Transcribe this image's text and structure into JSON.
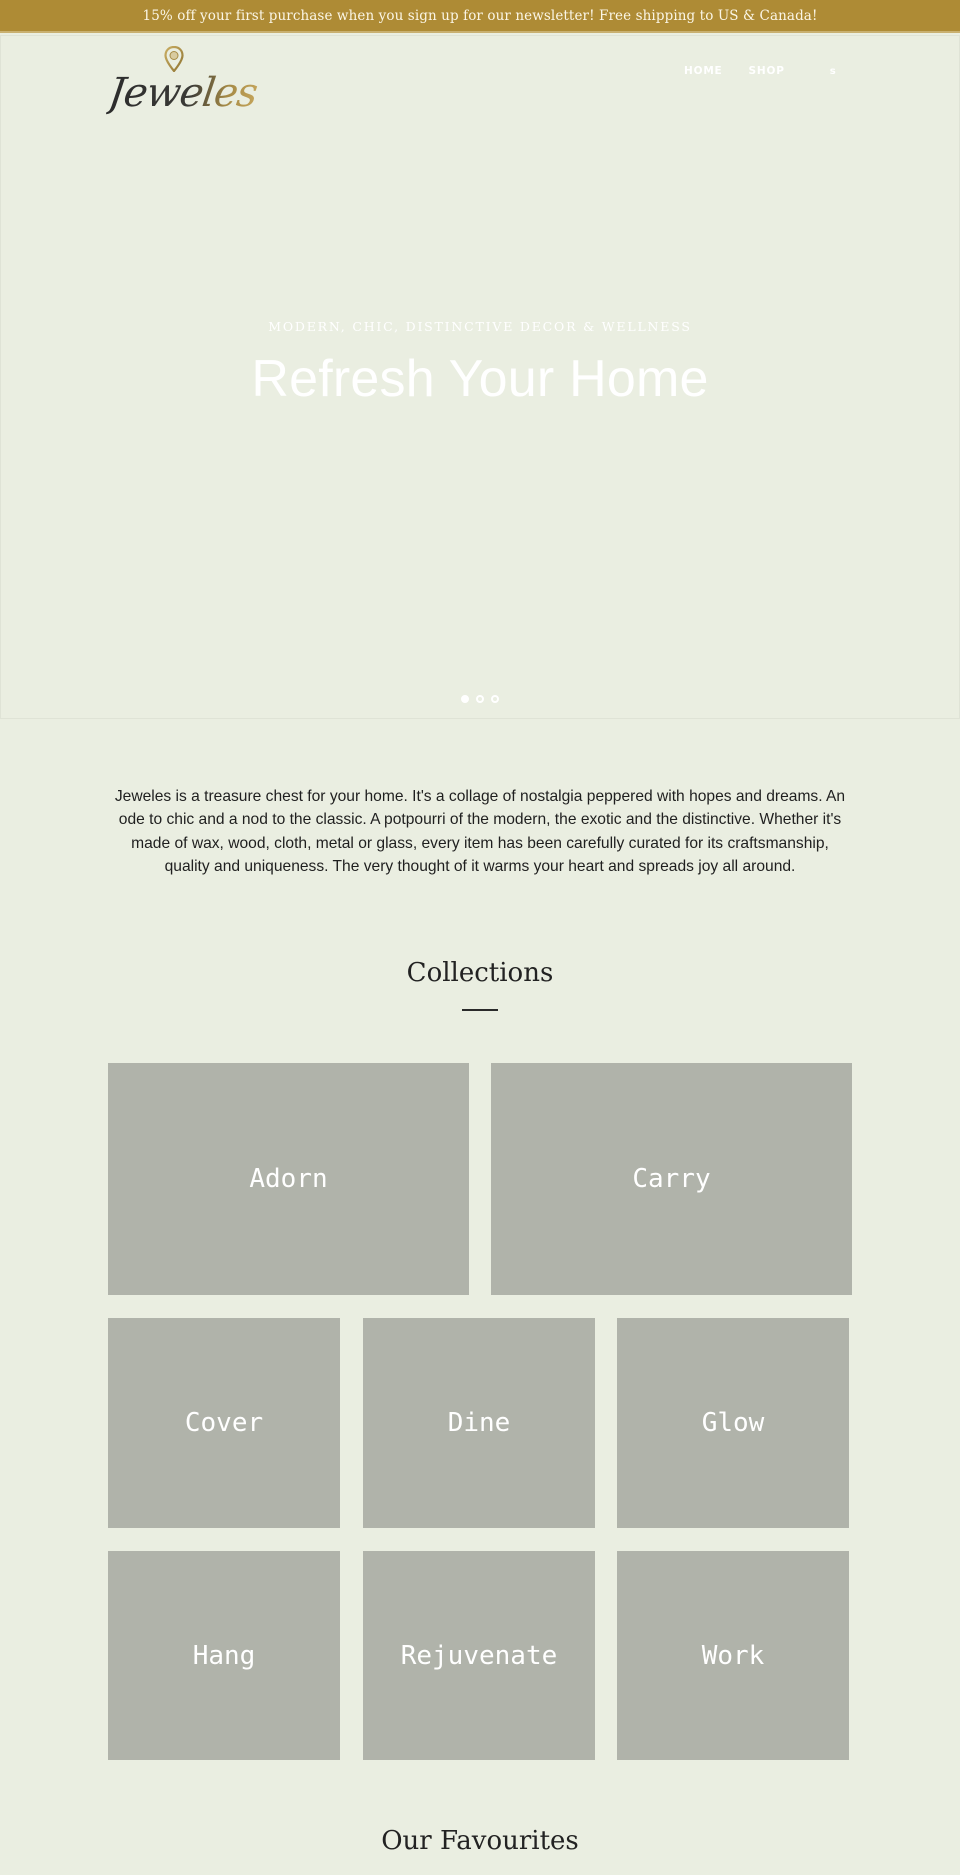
{
  "announcement": {
    "text": "15% off your first purchase when you sign up for our newsletter! Free shipping to US & Canada!",
    "background": "#ae8b35"
  },
  "header": {
    "logo_text": "Jeweles",
    "nav": {
      "home": "HOME",
      "shop": "SHOP",
      "search": "s"
    }
  },
  "hero": {
    "subtitle": "MODERN, CHIC, DISTINCTIVE DECOR & WELLNESS",
    "title": "Refresh Your Home",
    "slides": 3,
    "active_slide": 1
  },
  "intro": {
    "text": "Jeweles is a treasure chest for your home. It's a collage of nostalgia peppered with hopes and dreams. An ode to chic and a nod to the classic. A potpourri of the modern, the exotic and the distinctive. Whether it's made of wax, wood, cloth, metal or glass, every item has been carefully curated for its craftsmanship, quality and uniqueness. The very thought of it warms your heart and spreads joy all around."
  },
  "collections": {
    "title": "Collections",
    "items": [
      {
        "label": "Adorn"
      },
      {
        "label": "Carry"
      },
      {
        "label": "Cover"
      },
      {
        "label": "Dine"
      },
      {
        "label": "Glow"
      },
      {
        "label": "Hang"
      },
      {
        "label": "Rejuvenate"
      },
      {
        "label": "Work"
      }
    ]
  },
  "favourites": {
    "title": "Our Favourites"
  }
}
